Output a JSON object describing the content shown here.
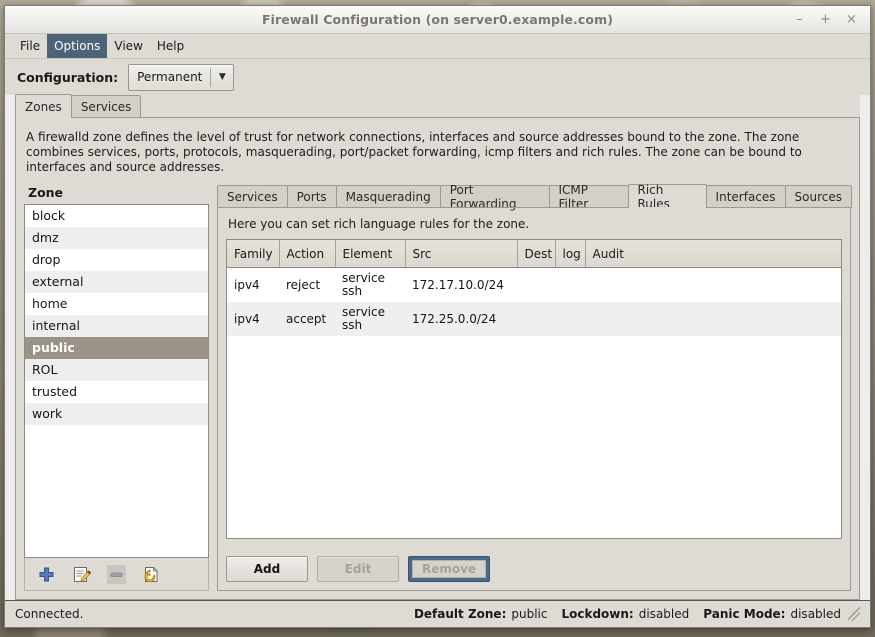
{
  "window": {
    "title": "Firewall Configuration (on server0.example.com)",
    "minimize": "–",
    "maximize": "+",
    "close": "×"
  },
  "menubar": {
    "items": [
      {
        "label": "File",
        "active": false
      },
      {
        "label": "Options",
        "active": true
      },
      {
        "label": "View",
        "active": false
      },
      {
        "label": "Help",
        "active": false
      }
    ]
  },
  "config": {
    "label": "Configuration:",
    "value": "Permanent",
    "arrow": "▼"
  },
  "outer_tabs": [
    {
      "label": "Zones",
      "selected": true
    },
    {
      "label": "Services",
      "selected": false
    }
  ],
  "zone_description": "A firewalld zone defines the level of trust for network connections, interfaces and source addresses bound to the zone. The zone combines services, ports, protocols, masquerading, port/packet forwarding, icmp filters and rich rules. The zone can be bound to interfaces and source addresses.",
  "zone_list": {
    "header": "Zone",
    "selected": "public",
    "items": [
      "block",
      "dmz",
      "drop",
      "external",
      "home",
      "internal",
      "public",
      "ROL",
      "trusted",
      "work"
    ]
  },
  "zone_toolbar": [
    {
      "name": "add-zone-icon",
      "enabled": true
    },
    {
      "name": "edit-zone-icon",
      "enabled": true
    },
    {
      "name": "remove-zone-icon",
      "enabled": false
    },
    {
      "name": "load-default-zone-icon",
      "enabled": true
    }
  ],
  "inner_tabs": [
    {
      "label": "Services",
      "selected": false
    },
    {
      "label": "Ports",
      "selected": false
    },
    {
      "label": "Masquerading",
      "selected": false
    },
    {
      "label": "Port Forwarding",
      "selected": false
    },
    {
      "label": "ICMP Filter",
      "selected": false
    },
    {
      "label": "Rich Rules",
      "selected": true
    },
    {
      "label": "Interfaces",
      "selected": false
    },
    {
      "label": "Sources",
      "selected": false
    }
  ],
  "rich_rules": {
    "hint": "Here you can set rich language rules for the zone.",
    "columns": [
      "Family",
      "Action",
      "Element",
      "Src",
      "Dest",
      "log",
      "Audit"
    ],
    "rows": [
      {
        "family": "ipv4",
        "action": "reject",
        "element": "service\nssh",
        "src": "172.17.10.0/24",
        "dest": "",
        "log": "",
        "audit": ""
      },
      {
        "family": "ipv4",
        "action": "accept",
        "element": "service\nssh",
        "src": "172.25.0.0/24",
        "dest": "",
        "log": "",
        "audit": ""
      }
    ]
  },
  "rule_buttons": {
    "add": "Add",
    "edit": "Edit",
    "remove": "Remove"
  },
  "statusbar": {
    "connection": "Connected.",
    "default_zone_label": "Default Zone:",
    "default_zone_value": "public",
    "lockdown_label": "Lockdown:",
    "lockdown_value": "disabled",
    "panic_label": "Panic Mode:",
    "panic_value": "disabled"
  },
  "colors": {
    "menu_highlight": "#4f6378",
    "selection": "#9b9388",
    "focus_blue": "#4b6a87",
    "window_bg": "#dedbd4"
  }
}
